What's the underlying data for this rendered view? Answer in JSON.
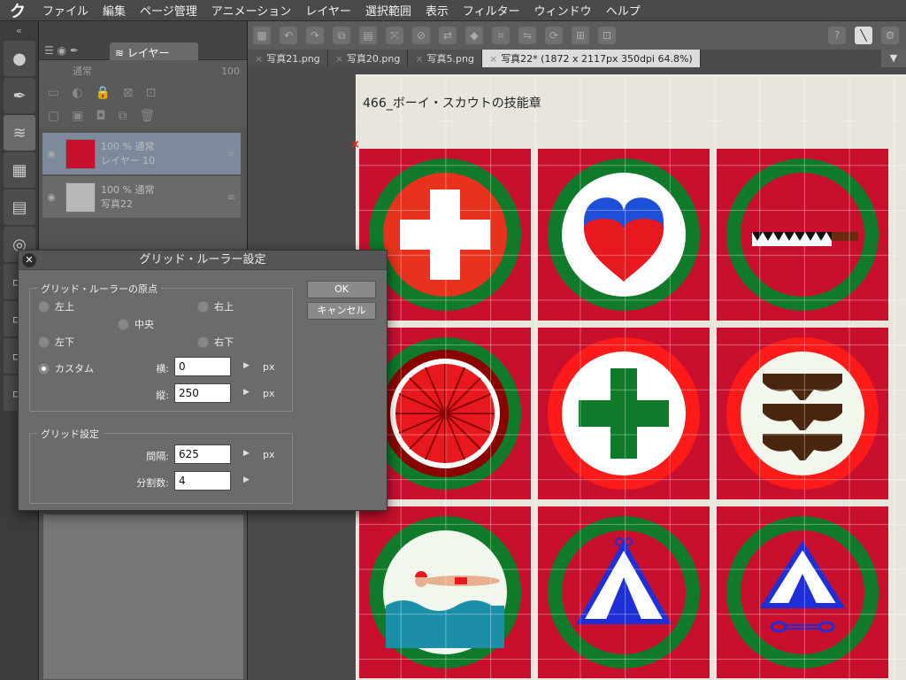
{
  "menubar": {
    "logo": "ク",
    "items": [
      "ファイル",
      "編集",
      "ページ管理",
      "アニメーション",
      "レイヤー",
      "選択範囲",
      "表示",
      "フィルター",
      "ウィンドウ",
      "ヘルプ"
    ]
  },
  "layer_panel": {
    "tab_label": "レイヤー",
    "blend_mode": "通常",
    "opacity": "100",
    "layers": [
      {
        "line1": "100 % 通常",
        "line2": "レイヤー 10"
      },
      {
        "line1": "100 % 通常",
        "line2": "写真22"
      }
    ]
  },
  "file_tabs": [
    "写真21.png",
    "写真20.png",
    "写真5.png",
    "写真22* (1872 x 2117px 350dpi 64.8%)"
  ],
  "canvas": {
    "title": "466_ボーイ・スカウトの技能章",
    "origin_marker": "×"
  },
  "dialog": {
    "title": "グリッド・ルーラー設定",
    "origin_group_label": "グリッド・ルーラーの原点",
    "origin_options": {
      "top_left": "左上",
      "top_right": "右上",
      "center": "中央",
      "bottom_left": "左下",
      "bottom_right": "右下",
      "custom": "カスタム"
    },
    "x_label": "横:",
    "x_value": "0",
    "y_label": "縦:",
    "y_value": "250",
    "unit": "px",
    "grid_group_label": "グリッド設定",
    "interval_label": "間隔:",
    "interval_value": "625",
    "divisions_label": "分割数:",
    "divisions_value": "4",
    "ok_label": "OK",
    "cancel_label": "キャンセル"
  },
  "colors": {
    "badge_red": "#c8102e",
    "badge_green": "#0f7a2a",
    "badge_brightred": "#ff1a1a"
  }
}
